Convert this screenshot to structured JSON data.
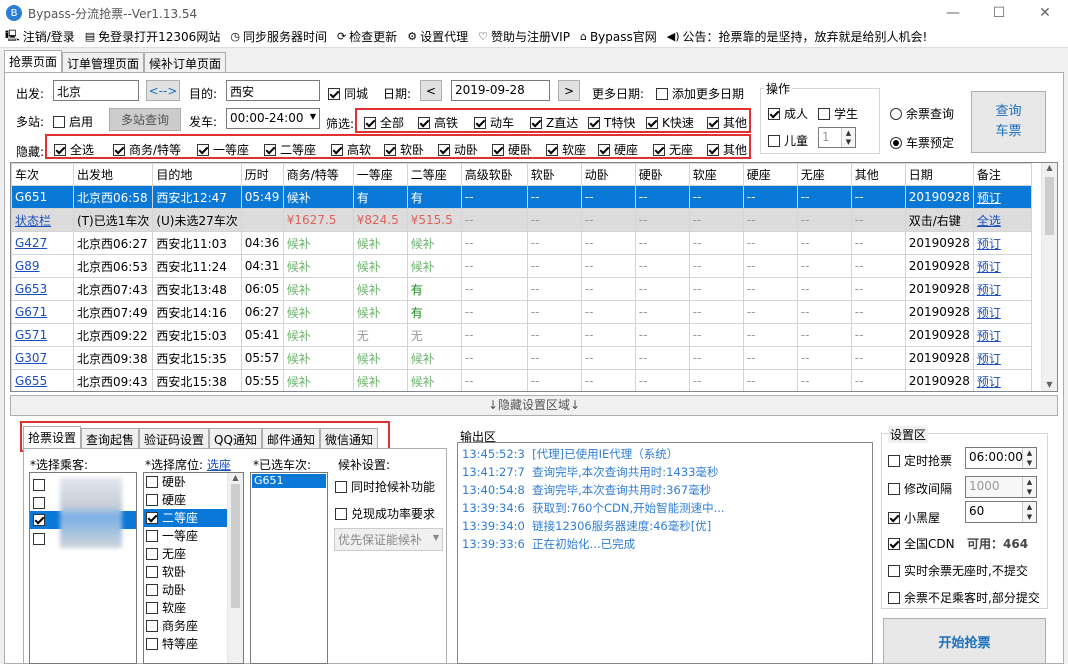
{
  "window": {
    "title": "Bypass-分流抢票--Ver1.13.54",
    "minimize": "—",
    "maximize": "☐",
    "close": "✕"
  },
  "menu": [
    {
      "icon": "monitor-icon",
      "glyph": "🖳",
      "label": "注销/登录"
    },
    {
      "icon": "browser-icon",
      "glyph": "▤",
      "label": "免登录打开12306网站"
    },
    {
      "icon": "clock-icon",
      "glyph": "◷",
      "label": "同步服务器时间"
    },
    {
      "icon": "refresh-icon",
      "glyph": "⟳",
      "label": "检查更新"
    },
    {
      "icon": "gear-icon",
      "glyph": "⚙",
      "label": "设置代理"
    },
    {
      "icon": "heart-icon",
      "glyph": "♡",
      "label": "赞助与注册VIP"
    },
    {
      "icon": "home-icon",
      "glyph": "⌂",
      "label": "Bypass官网"
    },
    {
      "icon": "speaker-icon",
      "glyph": "◀)",
      "label": "公告：抢票靠的是坚持，放弃就是给别人机会!"
    }
  ],
  "tabs": [
    "抢票页面",
    "订单管理页面",
    "候补订单页面"
  ],
  "search": {
    "from_label": "出发:",
    "from": "北京",
    "swap": "<-->",
    "to_label": "目的:",
    "to": "西安",
    "same_city": "同城",
    "date_label": "日期:",
    "date": "2019-09-28",
    "prev": "<",
    "next": ">",
    "more_dates_label": "更多日期:",
    "add_more_dates": "添加更多日期",
    "multi_label": "多站:",
    "enable": "启用",
    "multi_query": "多站查询",
    "depart_label": "发车:",
    "depart_time": "00:00-24:00",
    "filter_label": "筛选:",
    "hide_label": "隐藏:"
  },
  "filters": [
    "全部",
    "高铁",
    "动车",
    "Z直达",
    "T特快",
    "K快速",
    "其他"
  ],
  "hides": [
    "全选",
    "商务/特等",
    "一等座",
    "二等座",
    "高软",
    "软卧",
    "动卧",
    "硬卧",
    "软座",
    "硬座",
    "无座",
    "其他"
  ],
  "ops": {
    "title": "操作",
    "adult": "成人",
    "student": "学生",
    "child": "儿童",
    "child_count": "1",
    "remain_query": "余票查询",
    "ticket_book": "车票预定",
    "query_button": "查询\n车票"
  },
  "table": {
    "headers": [
      "车次",
      "出发地",
      "目的地",
      "历时",
      "商务/特等",
      "一等座",
      "二等座",
      "高级软卧",
      "软卧",
      "动卧",
      "硬卧",
      "软座",
      "硬座",
      "无座",
      "其他",
      "日期",
      "备注"
    ],
    "rows": [
      {
        "type": "sel",
        "cells": [
          "G651",
          "北京西06:58",
          "西安北12:47",
          "05:49",
          "候补",
          "有",
          "有",
          "--",
          "--",
          "--",
          "--",
          "--",
          "--",
          "--",
          "--",
          "20190928",
          "预订"
        ]
      },
      {
        "type": "stat",
        "cells": [
          "状态栏",
          "(T)已选1车次",
          "(U)未选27车次",
          "",
          "¥1627.5",
          "¥824.5",
          "¥515.5",
          "--",
          "--",
          "--",
          "--",
          "--",
          "--",
          "--",
          "--",
          "双击/右键",
          "全选"
        ]
      },
      {
        "type": "row",
        "cells": [
          "G427",
          "北京西06:27",
          "西安北11:03",
          "04:36",
          "候补",
          "候补",
          "候补",
          "--",
          "--",
          "--",
          "--",
          "--",
          "--",
          "--",
          "--",
          "20190928",
          "预订"
        ]
      },
      {
        "type": "row",
        "cells": [
          "G89",
          "北京西06:53",
          "西安北11:24",
          "04:31",
          "候补",
          "候补",
          "候补",
          "--",
          "--",
          "--",
          "--",
          "--",
          "--",
          "--",
          "--",
          "20190928",
          "预订"
        ]
      },
      {
        "type": "row",
        "cells": [
          "G653",
          "北京西07:43",
          "西安北13:48",
          "06:05",
          "候补",
          "候补",
          "有",
          "--",
          "--",
          "--",
          "--",
          "--",
          "--",
          "--",
          "--",
          "20190928",
          "预订"
        ]
      },
      {
        "type": "row",
        "cells": [
          "G671",
          "北京西07:49",
          "西安北14:16",
          "06:27",
          "候补",
          "候补",
          "有",
          "--",
          "--",
          "--",
          "--",
          "--",
          "--",
          "--",
          "--",
          "20190928",
          "预订"
        ]
      },
      {
        "type": "row",
        "cells": [
          "G571",
          "北京西09:22",
          "西安北15:03",
          "05:41",
          "候补",
          "无",
          "无",
          "--",
          "--",
          "--",
          "--",
          "--",
          "--",
          "--",
          "--",
          "20190928",
          "预订"
        ]
      },
      {
        "type": "row",
        "cells": [
          "G307",
          "北京西09:38",
          "西安北15:35",
          "05:57",
          "候补",
          "候补",
          "候补",
          "--",
          "--",
          "--",
          "--",
          "--",
          "--",
          "--",
          "--",
          "20190928",
          "预订"
        ]
      },
      {
        "type": "row",
        "cells": [
          "G655",
          "北京西09:43",
          "西安北15:38",
          "05:55",
          "候补",
          "候补",
          "候补",
          "--",
          "--",
          "--",
          "--",
          "--",
          "--",
          "--",
          "--",
          "20190928",
          "预订"
        ]
      }
    ]
  },
  "hide_settings": "↓隐藏设置区域↓",
  "bottom_tabs": [
    "抢票设置",
    "查询起售",
    "验证码设置",
    "QQ通知",
    "邮件通知",
    "微信通知"
  ],
  "settings": {
    "passenger_label": "*选择乘客:",
    "seat_label": "*选择席位:",
    "seat_select": "选座",
    "train_label": "*已选车次:",
    "waitlist_label": "候补设置:",
    "selected_train": "G651",
    "waitlist_opt1": "同时抢候补功能",
    "waitlist_opt2": "兑现成功率要求",
    "waitlist_dropdown": "优先保证能候补",
    "seats": [
      {
        "label": "硬卧",
        "on": false
      },
      {
        "label": "硬座",
        "on": false
      },
      {
        "label": "二等座",
        "on": true
      },
      {
        "label": "一等座",
        "on": false
      },
      {
        "label": "无座",
        "on": false
      },
      {
        "label": "软卧",
        "on": false
      },
      {
        "label": "动卧",
        "on": false
      },
      {
        "label": "软座",
        "on": false
      },
      {
        "label": "商务座",
        "on": false
      },
      {
        "label": "特等座",
        "on": false
      }
    ]
  },
  "output": {
    "title": "输出区",
    "logs": [
      {
        "time": "13:45:52:3",
        "msg": "[代理]已使用IE代理（系统）"
      },
      {
        "time": "13:41:27:7",
        "msg": "查询完毕,本次查询共用时:1433毫秒"
      },
      {
        "time": "13:40:54:8",
        "msg": "查询完毕,本次查询共用时:367毫秒"
      },
      {
        "time": "13:39:34:6",
        "msg": "获取到:760个CDN,开始智能测速中..."
      },
      {
        "time": "13:39:34:0",
        "msg": "链接12306服务器速度:46毫秒[优]"
      },
      {
        "time": "13:39:33:6",
        "msg": "正在初始化...已完成"
      }
    ]
  },
  "setarea": {
    "title": "设置区",
    "timed": "定时抢票",
    "timed_value": "06:00:00",
    "interval": "修改间隔",
    "interval_value": "1000",
    "blackroom": "小黑屋",
    "blackroom_value": "60",
    "cdn": "全国CDN",
    "cdn_avail": "可用：464",
    "opt1": "实时余票无座时,不提交",
    "opt2": "余票不足乘客时,部分提交",
    "start": "开始抢票"
  }
}
